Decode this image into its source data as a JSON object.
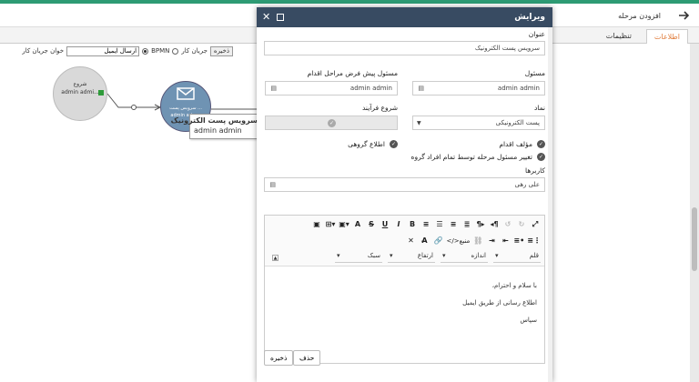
{
  "app": {
    "title": "افزودن مرحله",
    "tabs": [
      {
        "label": "اطلاعات",
        "active": true
      },
      {
        "label": "تنظیمات",
        "active": false
      }
    ],
    "accent_color": "#e07b39",
    "top_bar_color": "#2e9b74"
  },
  "canvas_toolbar": {
    "save_label": "ذخیره",
    "flow_label": "جریان کار",
    "bpmn_label": "BPMN",
    "input_value": "ارسال ایمیل",
    "reader_label": "خوان جریان کار"
  },
  "diagram": {
    "start_node": {
      "title": "شروع",
      "subtitle": "admin admi..."
    },
    "email_node": {
      "title": "سرویس پست ...",
      "subtitle": "admin adm..."
    },
    "tooltip": {
      "title": "سرویس پست الکترونیک",
      "subtitle": "admin admin"
    }
  },
  "dialog": {
    "title": "ویرایش",
    "header_color": "#384b62",
    "title_label": "عنوان",
    "title_value": "سرویس پست الکترونیک",
    "owner_label": "مسئول",
    "owner_value": "admin admin",
    "default_owner_label": "مسئول پیش فرض مراحل اقدام",
    "default_owner_value": "admin admin",
    "symbol_label": "نماد",
    "symbol_value": "پست الکترونیکی",
    "process_start_label": "شروع فرآیند",
    "author_label": "مؤلف اقدام",
    "group_notify_label": "اطلاع گروهی",
    "change_owner_label": "تغییر مسئول مرحله توسط تمام افراد گروه",
    "users_label": "کاربرها",
    "users_value": "علی رهی",
    "editor": {
      "source_label": "منبع",
      "font_label": "قلم",
      "size_label": "اندازه",
      "height_label": "ارتفاع",
      "style_label": "سبک",
      "lines": [
        "با سلام و احترام،",
        "اطلاع رسانی از طریق ایمیل",
        "سپاس"
      ]
    },
    "save_button": "ذخیره",
    "delete_button": "حذف"
  }
}
